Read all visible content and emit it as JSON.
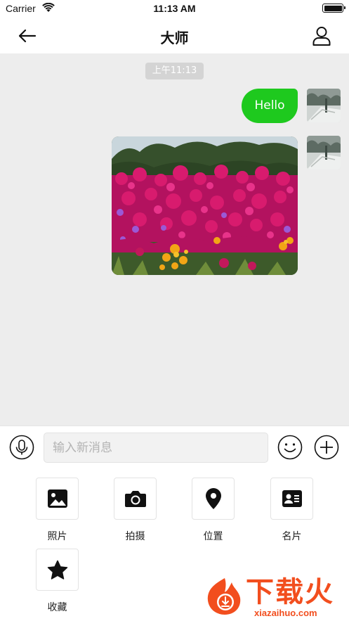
{
  "status_bar": {
    "carrier": "Carrier",
    "time": "11:13 AM"
  },
  "nav": {
    "title": "大师",
    "back_icon": "arrow-left-icon",
    "profile_icon": "user-icon"
  },
  "chat": {
    "time_label": "上午11:13",
    "messages": [
      {
        "type": "text",
        "text": "Hello",
        "bubble_color": "#1ec91e"
      },
      {
        "type": "image",
        "content": "flower-field-photo"
      }
    ]
  },
  "input_bar": {
    "placeholder": "输入新消息",
    "value": "",
    "voice_icon": "microphone-icon",
    "emoji_icon": "smiley-icon",
    "plus_icon": "plus-circle-icon"
  },
  "tools": {
    "photos": "照片",
    "camera": "拍摄",
    "location": "位置",
    "card": "名片",
    "favorites": "收藏"
  },
  "watermark": {
    "text": "下载火",
    "domain": "xiazaihuo.com"
  },
  "colors": {
    "accent_green": "#1ec91e",
    "chat_background": "#ededed",
    "watermark_orange": "#f24e1e"
  }
}
